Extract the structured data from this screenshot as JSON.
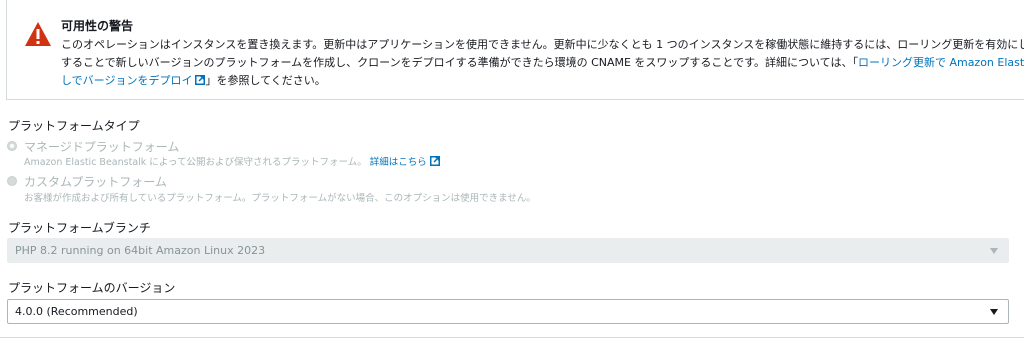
{
  "alert": {
    "title": "可用性の警告",
    "line1": "このオペレーションはインスタンスを置き換えます。更新中はアプリケーションを使用できません。更新中に少なくとも 1 つのインスタンスを稼働状態に維持するには、ローリング更新を有効にしま",
    "line2_text": "することで新しいバージョンのプラットフォームを作成し、クローンをデプロイする準備ができたら環境の CNAME をスワップすることです。詳細については、「",
    "line2_link": "ローリング更新で Amazon Elastic B",
    "line3_link": "しでバージョンをデプロイ",
    "line3_tail": "」を参照してください。",
    "icon": "warning-icon",
    "color": "#d13212"
  },
  "platform_type": {
    "label": "プラットフォームタイプ",
    "options": [
      {
        "label": "マネージドプラットフォーム",
        "desc": "Amazon Elastic Beanstalk によって公開および保守されるプラットフォーム。",
        "link": "詳細はこちら",
        "selected": true
      },
      {
        "label": "カスタムプラットフォーム",
        "desc": "お客様が作成および所有しているプラットフォーム。プラットフォームがない場合、このオプションは使用できません。",
        "selected": false
      }
    ]
  },
  "platform_branch": {
    "label": "プラットフォームブランチ",
    "value": "PHP 8.2 running on 64bit Amazon Linux 2023"
  },
  "platform_version": {
    "label": "プラットフォームのバージョン",
    "value": "4.0.0 (Recommended)"
  },
  "colors": {
    "link": "#0073bb",
    "disabled_text": "#aab7b8"
  }
}
